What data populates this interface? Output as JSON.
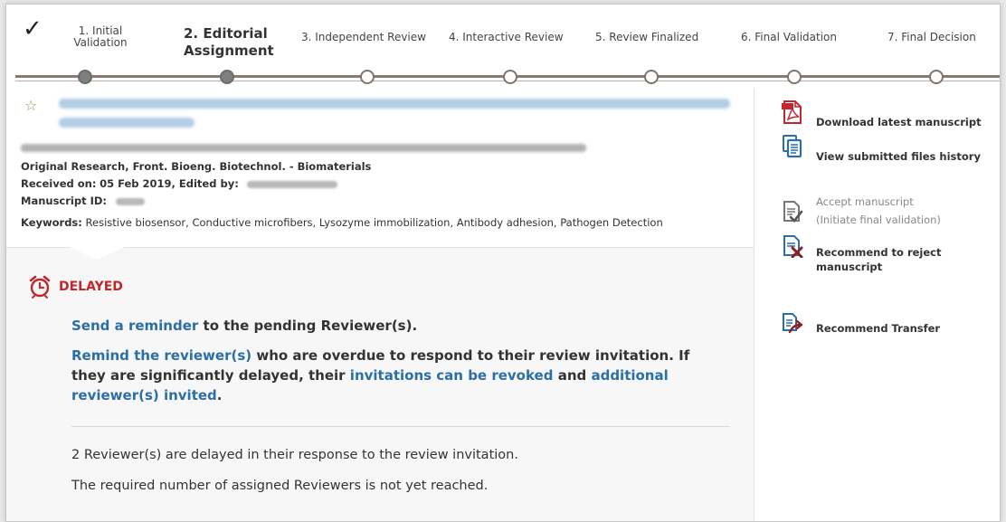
{
  "steps": {
    "items": [
      {
        "label_1": "1. Initial",
        "label_2": "Validation"
      },
      {
        "label_1": "2. Editorial",
        "label_2": "Assignment"
      },
      {
        "label": "3. Independent Review"
      },
      {
        "label": "4. Interactive Review"
      },
      {
        "label": "5. Review Finalized"
      },
      {
        "label": "6. Final Validation"
      },
      {
        "label": "7. Final Decision"
      }
    ]
  },
  "manuscript": {
    "article_type_line": "Original Research, Front. Bioeng. Biotechnol. - Biomaterials",
    "received_label": "Received on:",
    "received_value": "05 Feb 2019, Edited by:",
    "manuscript_id_label": "Manuscript ID:",
    "keywords_label": "Keywords:",
    "keywords_value": "Resistive biosensor, Conductive microfibers, Lysozyme immobilization, Antibody adhesion, Pathogen Detection"
  },
  "status": {
    "badge": "DELAYED",
    "send_reminder_link": "Send a reminder",
    "send_reminder_rest": " to the pending Reviewer(s).",
    "remind_link": "Remind the reviewer(s)",
    "remind_rest_1": " who are overdue to respond to their review invitation. If they are significantly delayed, their ",
    "revoke_link": "invitations can be revoked",
    "remind_rest_2": " and ",
    "additional_link": "additional reviewer(s) invited",
    "remind_rest_3": ".",
    "delayed_info": "2 Reviewer(s) are delayed in their response to the review invitation.",
    "required_info": "The required number of assigned Reviewers is not yet reached."
  },
  "actions": {
    "download": "Download latest manuscript",
    "history": "View submitted files history",
    "accept_1": "Accept manuscript",
    "accept_2": "(Initiate final validation)",
    "reject_1": "Recommend to reject",
    "reject_2": "manuscript",
    "transfer": "Recommend Transfer"
  },
  "colors": {
    "link": "#2c6ea6",
    "delayed": "#c0282d",
    "pdf": "#c0282d",
    "icon_blue": "#2c6ea6"
  }
}
